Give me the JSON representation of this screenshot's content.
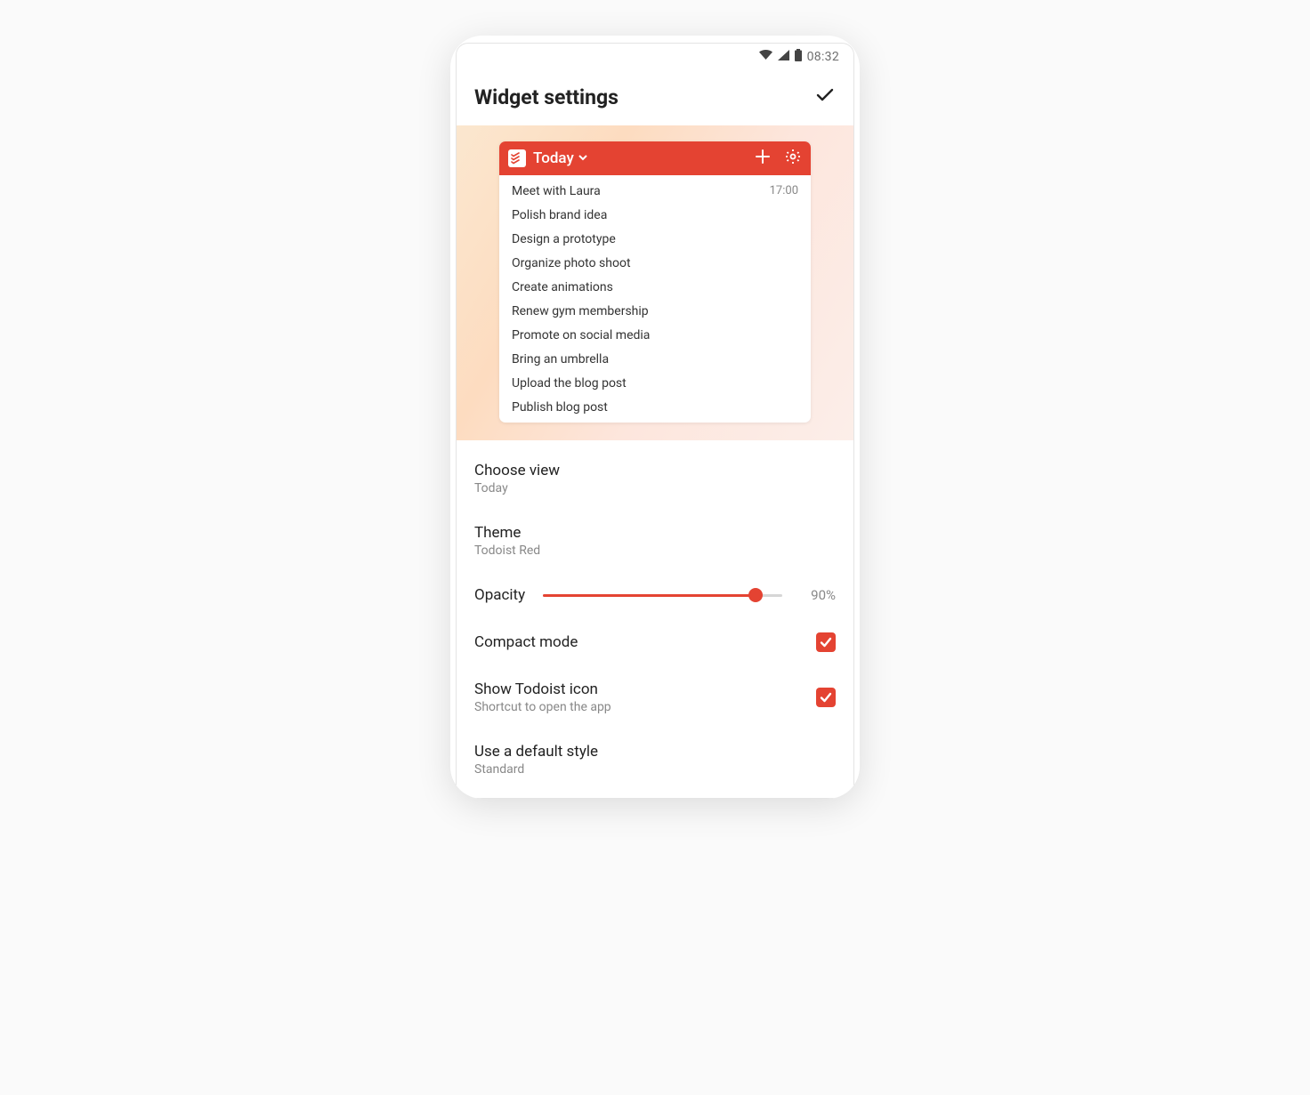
{
  "status_bar": {
    "time": "08:32"
  },
  "header": {
    "title": "Widget settings"
  },
  "widget": {
    "view_label": "Today",
    "tasks": [
      {
        "title": "Meet with Laura",
        "time": "17:00"
      },
      {
        "title": "Polish brand idea",
        "time": ""
      },
      {
        "title": "Design a prototype",
        "time": ""
      },
      {
        "title": "Organize photo shoot",
        "time": ""
      },
      {
        "title": "Create animations",
        "time": ""
      },
      {
        "title": "Renew gym membership",
        "time": ""
      },
      {
        "title": "Promote on social media",
        "time": ""
      },
      {
        "title": "Bring an umbrella",
        "time": ""
      },
      {
        "title": "Upload the blog post",
        "time": ""
      },
      {
        "title": "Publish blog post",
        "time": ""
      }
    ]
  },
  "settings": {
    "choose_view": {
      "label": "Choose view",
      "value": "Today"
    },
    "theme": {
      "label": "Theme",
      "value": "Todoist Red"
    },
    "opacity": {
      "label": "Opacity",
      "percent": 90,
      "display": "90%"
    },
    "compact_mode": {
      "label": "Compact mode",
      "checked": true
    },
    "show_icon": {
      "label": "Show Todoist icon",
      "subtitle": "Shortcut to open the app",
      "checked": true
    },
    "default_style": {
      "label": "Use a default style",
      "value": "Standard"
    }
  },
  "colors": {
    "accent": "#e44332"
  }
}
